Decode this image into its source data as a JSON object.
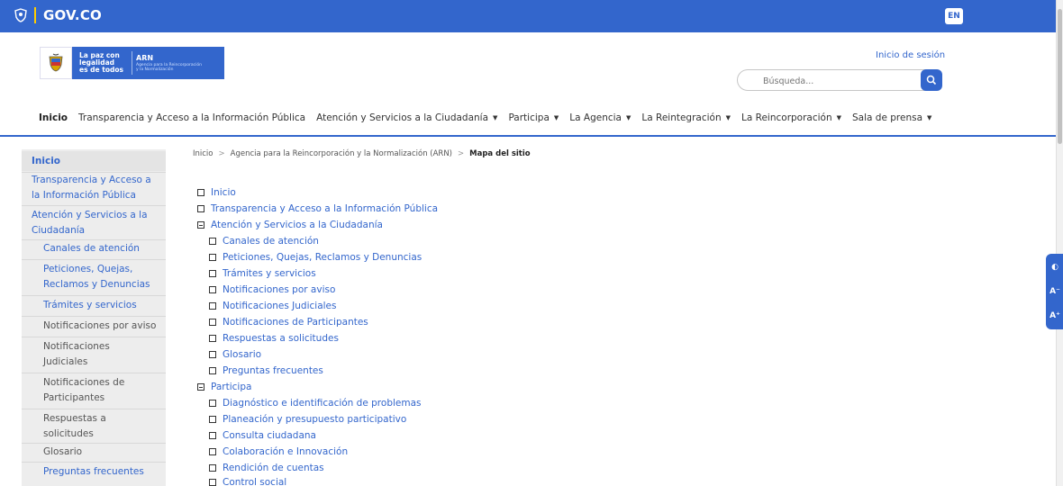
{
  "gov_bar": {
    "logo_text": "GOV.CO",
    "language": "EN"
  },
  "header": {
    "brand_line1": "La paz con",
    "brand_line2": "legalidad",
    "brand_line3": "es de todos",
    "brand_arn": "ARN",
    "brand_sub1": "Agencia para la Reincorporación",
    "brand_sub2": "y la Normalización",
    "login": "Inicio de sesión",
    "search_placeholder": "Búsqueda..."
  },
  "menu": {
    "items": [
      "Inicio",
      "Transparencia y Acceso a la Información Pública",
      "Atención y Servicios a la Ciudadanía",
      "Participa",
      "La Agencia",
      "La Reintegración",
      "La Reincorporación",
      "Sala de prensa"
    ]
  },
  "sidebar": {
    "items": [
      "Inicio",
      "Transparencia y Acceso a",
      "la Información Pública",
      "Atención y Servicios a la",
      "Ciudadanía"
    ],
    "subitems": [
      "Canales de atención",
      "Peticiones, Quejas,",
      "Reclamos y Denuncias",
      "Trámites y servicios",
      "Notificaciones por aviso",
      "Notificaciones",
      "Judiciales",
      "Notificaciones de",
      "Participantes",
      "Respuestas a",
      "solicitudes",
      "Glosario",
      "Preguntas frecuentes"
    ]
  },
  "breadcrumb": {
    "items": [
      "Inicio",
      "Agencia para la Reincorporación y la Normalización (ARN)"
    ],
    "separator": ">",
    "current": "Mapa del sitio"
  },
  "sitemap": {
    "nodes": [
      "Inicio",
      "Transparencia y Acceso a la Información Pública",
      "Atención y Servicios a la Ciudadanía",
      "Canales de atención",
      "Peticiones, Quejas, Reclamos y Denuncias",
      "Trámites y servicios",
      "Notificaciones por aviso",
      "Notificaciones Judiciales",
      "Notificaciones de Participantes",
      "Respuestas a solicitudes",
      "Glosario",
      "Preguntas frecuentes",
      "Participa",
      "Diagnóstico e identificación de problemas",
      "Planeación y presupuesto participativo",
      "Consulta ciudadana",
      "Colaboración e Innovación",
      "Rendición de cuentas",
      "Control social"
    ]
  },
  "accessibility": {
    "contrast": "◐",
    "decrease": "A⁻",
    "increase": "A⁺"
  },
  "colors": {
    "primary": "#3366cc",
    "accent": "#ffcc00",
    "sidebar_bg": "#ededed"
  }
}
